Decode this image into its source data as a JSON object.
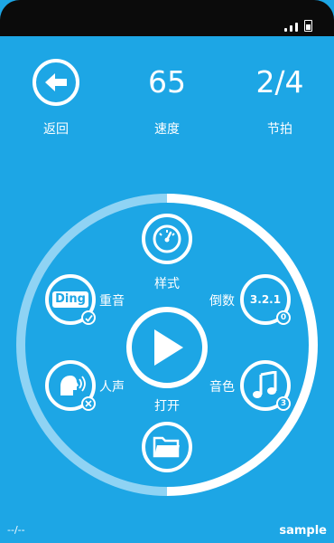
{
  "top_bar": {
    "back_label": "返回",
    "tempo_value": "65",
    "tempo_label": "速度",
    "meter_value": "2/4",
    "meter_label": "节拍"
  },
  "dial": {
    "style_label": "样式",
    "accent_label": "重音",
    "accent_icon_text": "Ding",
    "countdown_label": "倒数",
    "countdown_icon_text": "3.2.1",
    "countdown_badge": "0",
    "voice_label": "人声",
    "sound_label": "音色",
    "sound_badge": "3",
    "open_label": "打开"
  },
  "footer": {
    "left_text": "--/--",
    "right_text": "sample"
  },
  "colors": {
    "background": "#1da6e5",
    "ring_light": "#8fd3f4",
    "ring_white": "#ffffff"
  }
}
